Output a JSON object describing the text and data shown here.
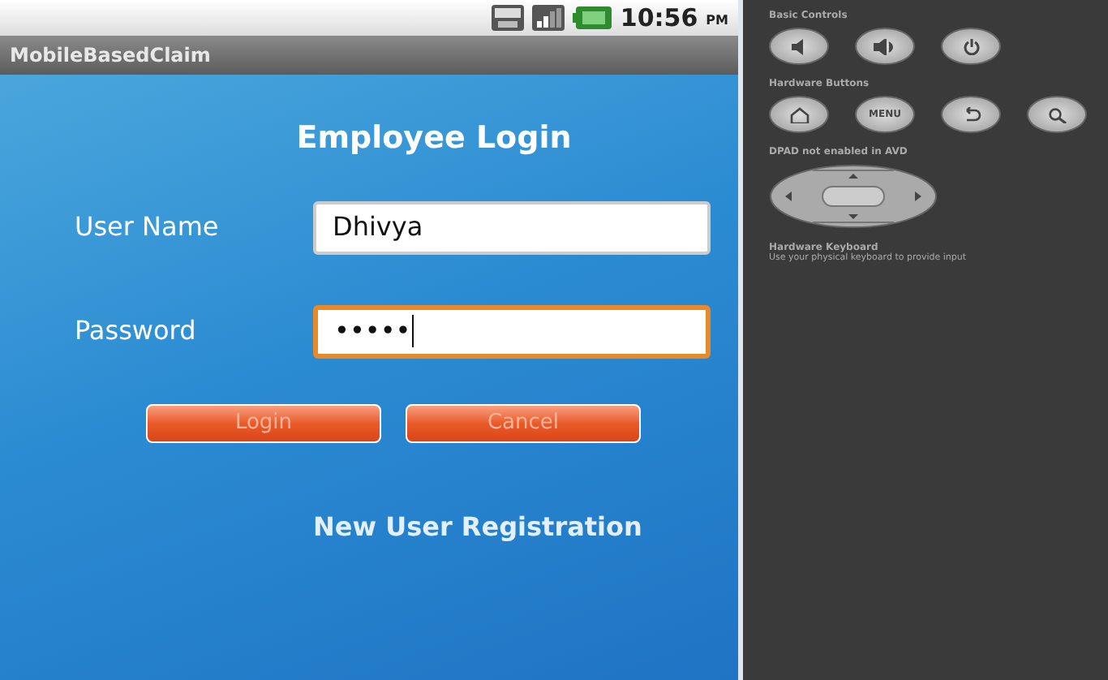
{
  "status_bar": {
    "time": "10:56",
    "ampm": "PM"
  },
  "app_title": "MobileBasedClaim",
  "login": {
    "heading": "Employee Login",
    "fields": [
      {
        "label": "User Name",
        "value": "Dhivya",
        "focused": false
      },
      {
        "label": "Password",
        "value": "•••••",
        "focused": true
      }
    ],
    "buttons": [
      "Login",
      "Cancel"
    ],
    "link": "New User Registration"
  },
  "controls": {
    "basic_title": "Basic Controls",
    "hardware_title": "Hardware Buttons",
    "menu_key": "MENU",
    "dpad_note": "DPAD not enabled in AVD",
    "keyboard_title": "Hardware Keyboard",
    "keyboard_note": "Use your physical keyboard to provide input"
  }
}
